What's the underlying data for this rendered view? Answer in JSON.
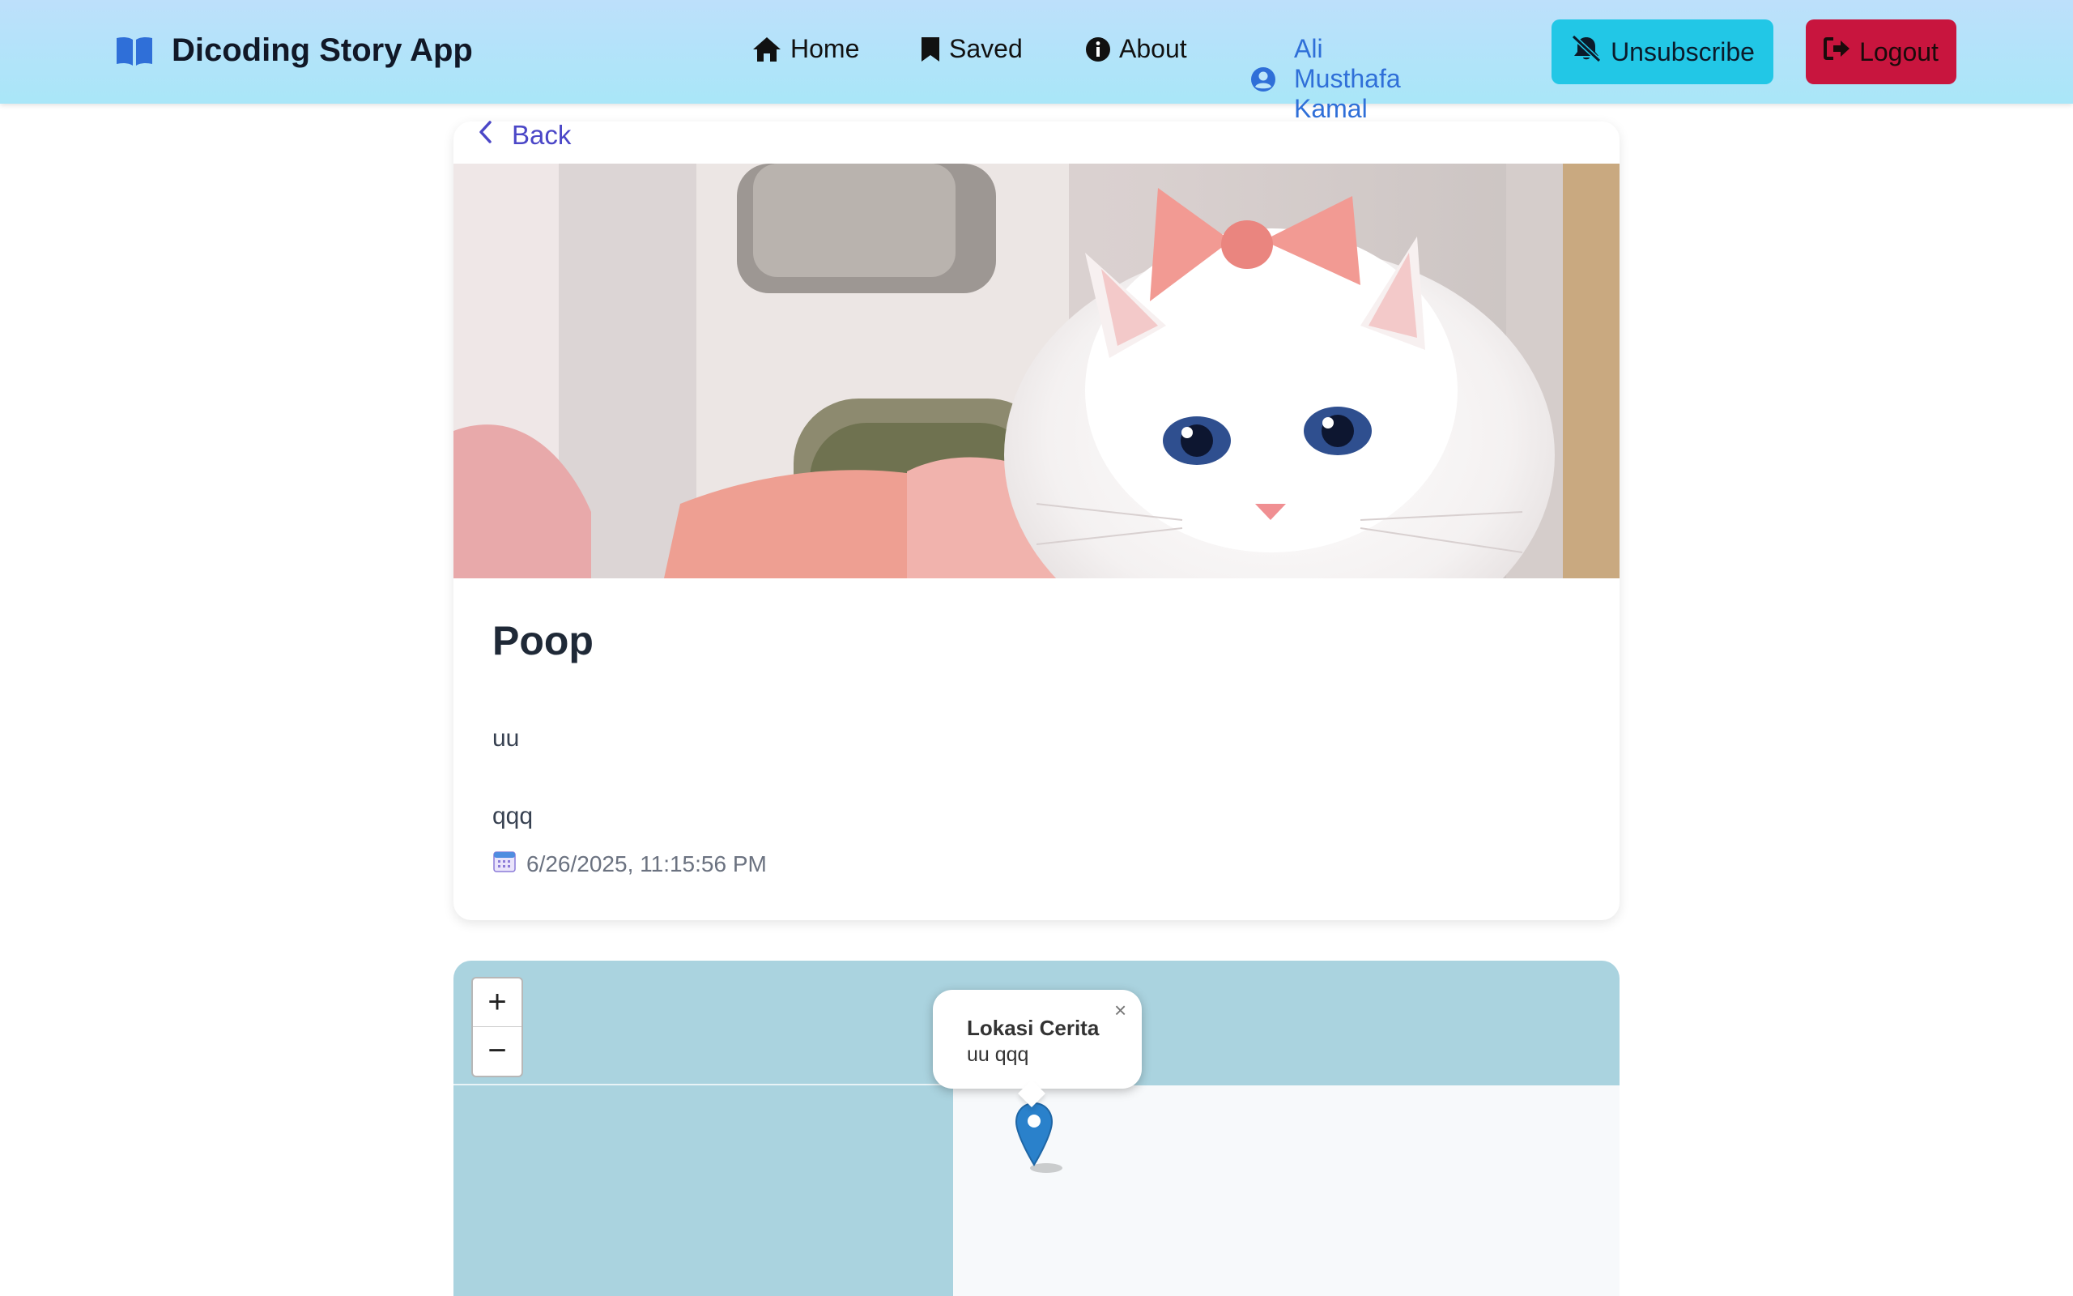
{
  "header": {
    "app_title": "Dicoding Story App",
    "nav": {
      "home": "Home",
      "saved": "Saved",
      "about": "About",
      "user": "Ali Musthafa Kamal"
    },
    "unsubscribe_label": "Unsubscribe",
    "logout_label": "Logout"
  },
  "back_label": "Back",
  "story": {
    "title": "Poop",
    "description": "uu\nqqq",
    "date": "6/26/2025, 11:15:56 PM"
  },
  "map": {
    "popup_title": "Lokasi Cerita",
    "popup_text": "uu qqq",
    "zoom_in": "+",
    "zoom_out": "−",
    "close": "×"
  },
  "colors": {
    "header_bg": "#bde0fb",
    "unsubscribe_bg": "#22c7e6",
    "logout_bg": "#c8153e",
    "user_link": "#2f6fd8",
    "back_link": "#4b47c7",
    "water": "#aad3df",
    "marker": "#2a81cb"
  }
}
